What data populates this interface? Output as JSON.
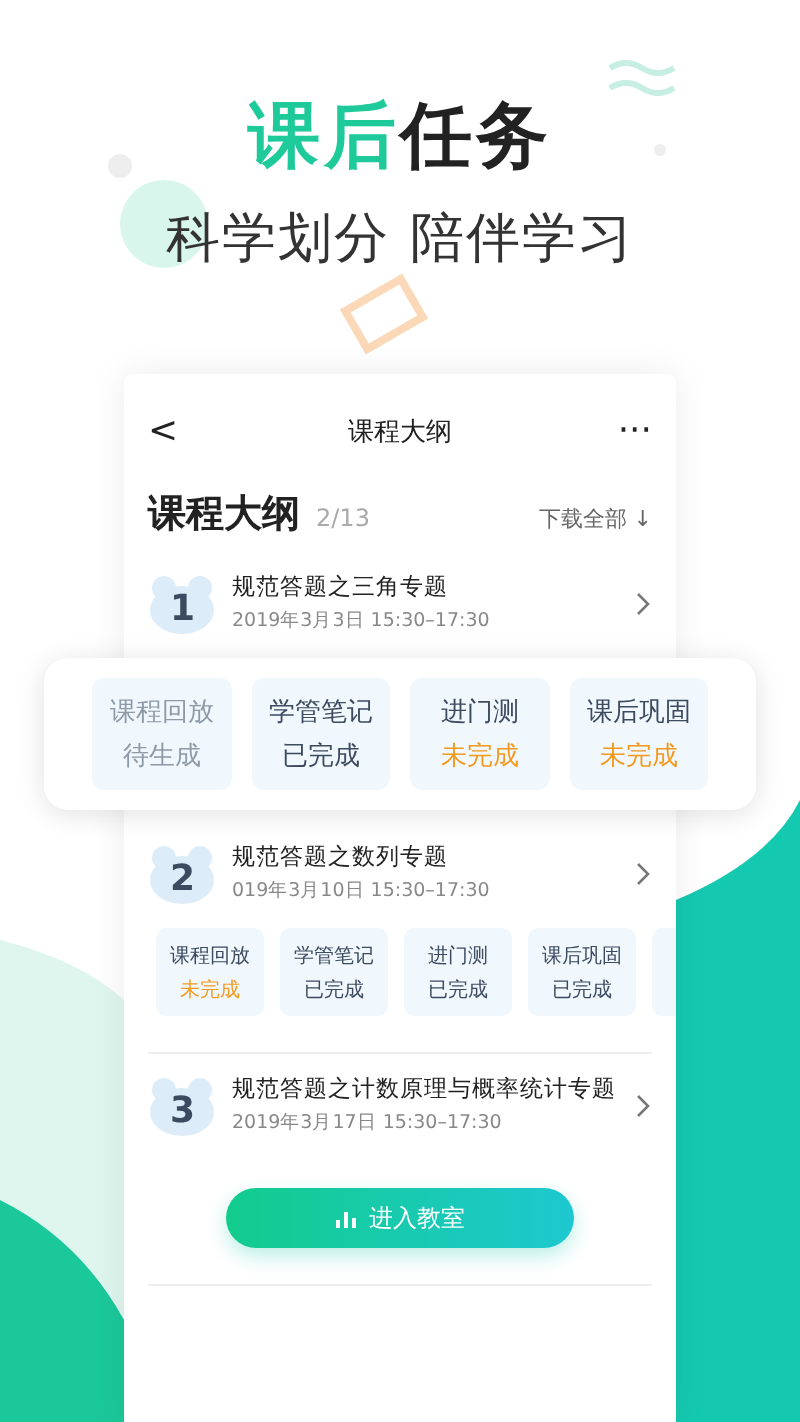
{
  "headline": {
    "accent": "课后",
    "rest": "任务"
  },
  "subtitle": "科学划分 陪伴学习",
  "nav": {
    "back": "<",
    "title": "课程大纲",
    "more": "···"
  },
  "heading": {
    "title": "课程大纲",
    "count": "2/13",
    "download": "下载全部 ↓"
  },
  "lessons": [
    {
      "number": "1",
      "title": "规范答题之三角专题",
      "time": "2019年3月3日 15:30–17:30",
      "popup_tasks": [
        {
          "label": "课程回放",
          "status": "待生成",
          "kind": "unavailable"
        },
        {
          "label": "学管笔记",
          "status": "已完成",
          "kind": "done"
        },
        {
          "label": "进门测",
          "status": "未完成",
          "kind": "pending"
        },
        {
          "label": "课后巩固",
          "status": "未完成",
          "kind": "pending"
        }
      ]
    },
    {
      "number": "2",
      "title": "规范答题之数列专题",
      "time": "019年3月10日 15:30–17:30",
      "tasks": [
        {
          "label": "课程回放",
          "status": "未完成",
          "kind": "pending"
        },
        {
          "label": "学管笔记",
          "status": "已完成",
          "kind": "done"
        },
        {
          "label": "进门测",
          "status": "已完成",
          "kind": "done"
        },
        {
          "label": "课后巩固",
          "status": "已完成",
          "kind": "done"
        }
      ]
    },
    {
      "number": "3",
      "title": "规范答题之计数原理与概率统计专题",
      "time": "2019年3月17日 15:30–17:30",
      "button": "进入教室"
    }
  ]
}
